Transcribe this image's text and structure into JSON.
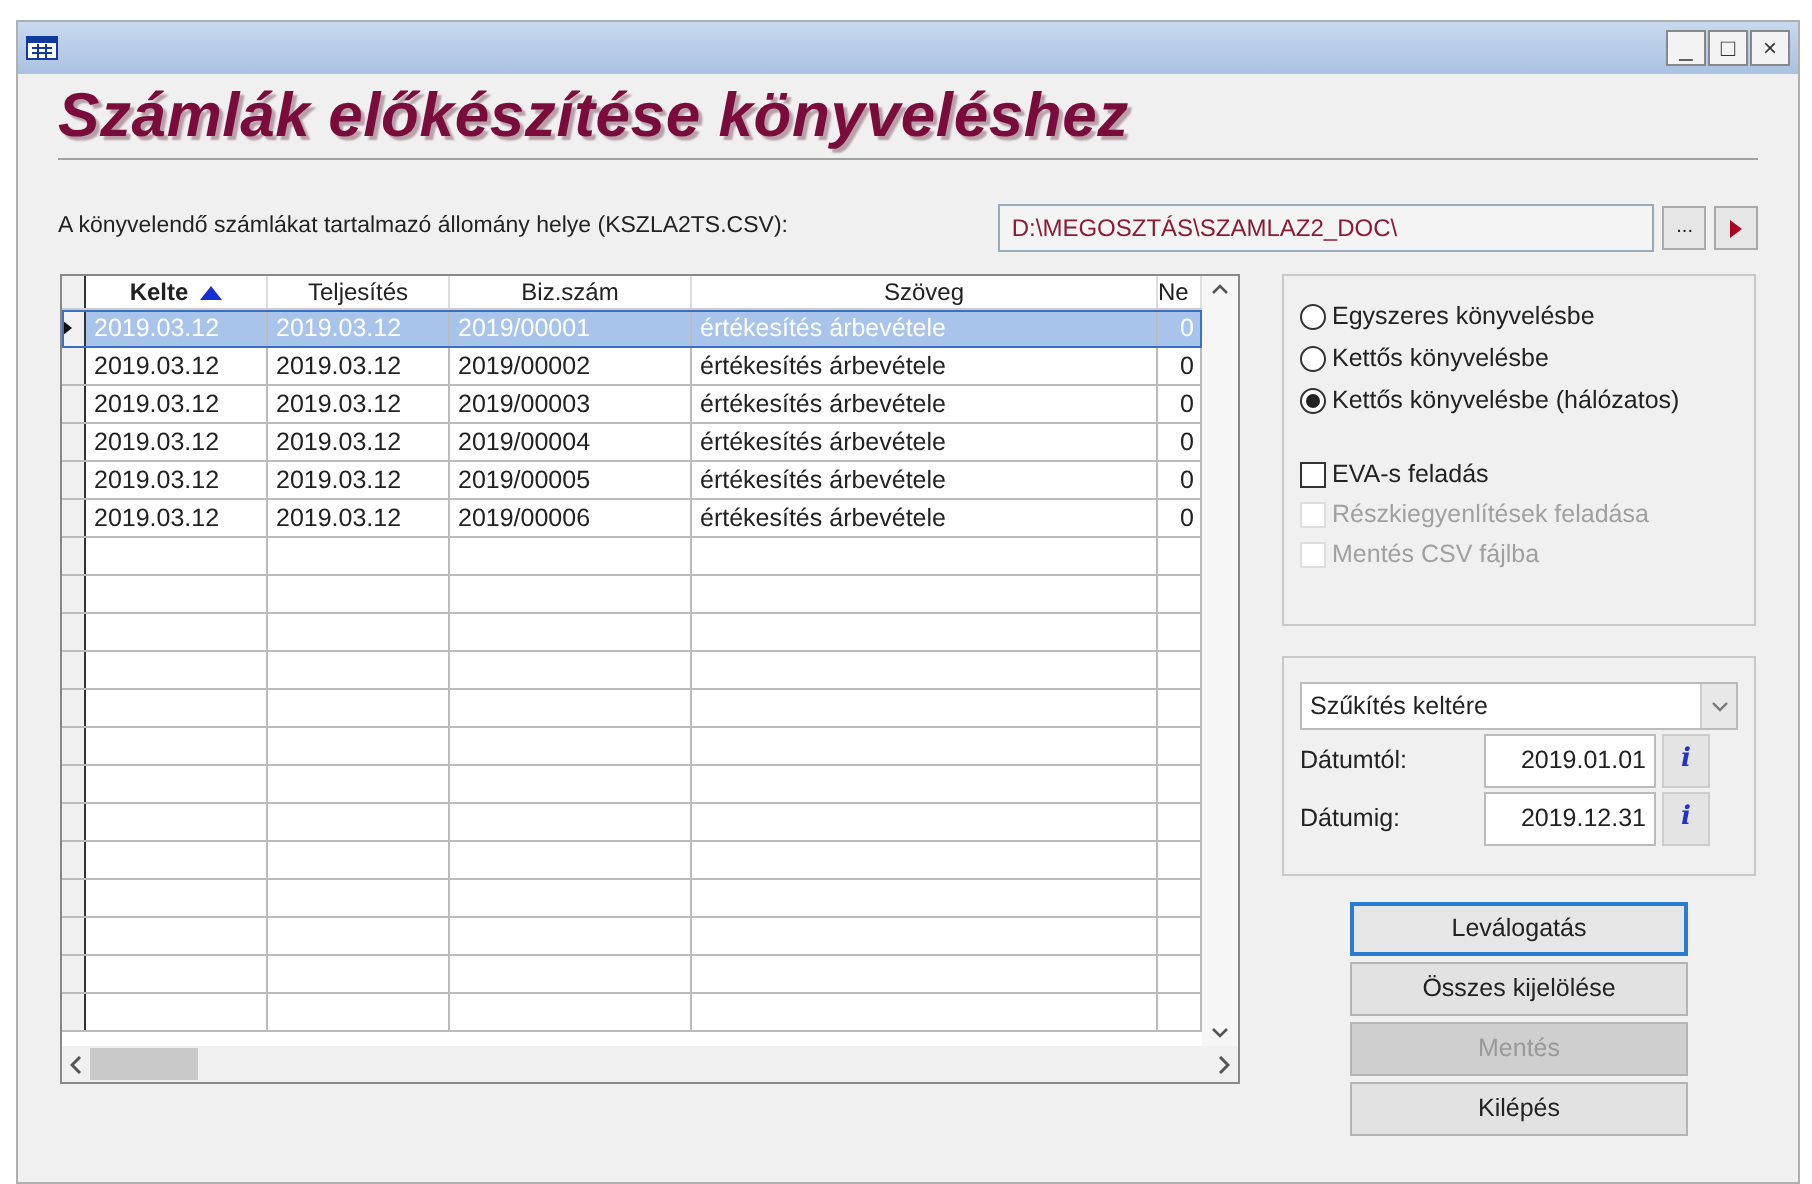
{
  "window": {
    "title_bar_buttons": [
      "_",
      "□",
      "×"
    ]
  },
  "heading": "Számlák előkészítése könyveléshez",
  "path_field": {
    "label": "A könyvelendő számlákat tartalmazó állomány helye (KSZLA2TS.CSV):",
    "value": "D:\\MEGOSZTÁS\\SZAMLAZ2_DOC\\",
    "browse": "..."
  },
  "table": {
    "columns": [
      {
        "label": "Kelte",
        "sorted": true
      },
      {
        "label": "Teljesítés",
        "sorted": false
      },
      {
        "label": "Biz.szám",
        "sorted": false
      },
      {
        "label": "Szöveg",
        "sorted": false
      },
      {
        "label": "Ne",
        "sorted": false
      }
    ],
    "rows": [
      {
        "selected": true,
        "cells": [
          "2019.03.12",
          "2019.03.12",
          "2019/00001",
          "értékesítés árbevétele",
          "0"
        ]
      },
      {
        "selected": false,
        "cells": [
          "2019.03.12",
          "2019.03.12",
          "2019/00002",
          "értékesítés árbevétele",
          "0"
        ]
      },
      {
        "selected": false,
        "cells": [
          "2019.03.12",
          "2019.03.12",
          "2019/00003",
          "értékesítés árbevétele",
          "0"
        ]
      },
      {
        "selected": false,
        "cells": [
          "2019.03.12",
          "2019.03.12",
          "2019/00004",
          "értékesítés árbevétele",
          "0"
        ]
      },
      {
        "selected": false,
        "cells": [
          "2019.03.12",
          "2019.03.12",
          "2019/00005",
          "értékesítés árbevétele",
          "0"
        ]
      },
      {
        "selected": false,
        "cells": [
          "2019.03.12",
          "2019.03.12",
          "2019/00006",
          "értékesítés árbevétele",
          "0"
        ]
      }
    ]
  },
  "mode_options": [
    {
      "label": "Egyszeres könyvelésbe",
      "selected": false
    },
    {
      "label": "Kettős könyvelésbe",
      "selected": false
    },
    {
      "label": "Kettős könyvelésbe (hálózatos)",
      "selected": true
    }
  ],
  "checkboxes": [
    {
      "label": "EVA-s feladás",
      "checked": false,
      "disabled": false
    },
    {
      "label": "Részkiegyenlítések feladása",
      "checked": false,
      "disabled": true
    },
    {
      "label": "Mentés CSV fájlba",
      "checked": false,
      "disabled": true
    }
  ],
  "filter": {
    "value": "Szűkítés keltére",
    "dates": [
      {
        "label": "Dátumtól:",
        "value": "2019.01.01",
        "info": "i"
      },
      {
        "label": "Dátumig:",
        "value": "2019.12.31",
        "info": "i"
      }
    ]
  },
  "buttons": [
    {
      "label": "Leválogatás",
      "focused": true,
      "disabled": false
    },
    {
      "label": "Összes kijelölése",
      "focused": false,
      "disabled": false
    },
    {
      "label": "Mentés",
      "focused": false,
      "disabled": true
    },
    {
      "label": "Kilépés",
      "focused": false,
      "disabled": false
    }
  ]
}
